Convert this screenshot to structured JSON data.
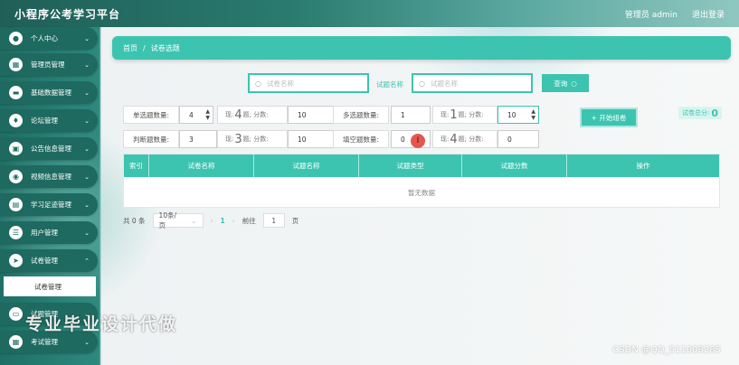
{
  "header": {
    "title": "小程序公考学习平台",
    "admin_label": "管理员 admin",
    "logout_label": "退出登录"
  },
  "sidebar": {
    "items": [
      {
        "label": "个人中心",
        "icon": "user-icon"
      },
      {
        "label": "管理员管理",
        "icon": "grid-icon"
      },
      {
        "label": "基础数据管理",
        "icon": "briefcase-icon"
      },
      {
        "label": "论坛管理",
        "icon": "thumb-icon"
      },
      {
        "label": "公告信息管理",
        "icon": "calendar-icon"
      },
      {
        "label": "视频信息管理",
        "icon": "pin-icon"
      },
      {
        "label": "学习足迹管理",
        "icon": "clipboard-icon"
      },
      {
        "label": "用户管理",
        "icon": "sliders-icon"
      },
      {
        "label": "试卷管理",
        "icon": "send-icon"
      },
      {
        "label": "试题管理",
        "icon": "ticket-icon"
      },
      {
        "label": "考试管理",
        "icon": "grid-icon"
      }
    ],
    "sub_item": "试卷管理"
  },
  "breadcrumb": {
    "home": "首页",
    "sep": "/",
    "current": "试卷选题"
  },
  "search": {
    "paper_placeholder": "试卷名称",
    "question_label": "试题名称",
    "question_placeholder": "试题名称",
    "query_label": "查询"
  },
  "config": {
    "single": {
      "label": "单选题数量:",
      "value": "4",
      "have_prefix": "现:",
      "have_count": "4",
      "have_suffix": "题; 分数:",
      "score": "10"
    },
    "multi": {
      "label": "多选题数量:",
      "value": "1",
      "have_prefix": "现:",
      "have_count": "1",
      "have_suffix": "题; 分数:",
      "score": "10"
    },
    "judge": {
      "label": "判断题数量:",
      "value": "3",
      "have_prefix": "现:",
      "have_count": "3",
      "have_suffix": "题; 分数:",
      "score": "10"
    },
    "fill": {
      "label": "填空题数量:",
      "value": "0",
      "have_prefix": "现:",
      "have_count": "4",
      "have_suffix": "题; 分数:",
      "score": "0"
    },
    "generate_label": "+ 开始组卷",
    "total_label": "试卷总分:",
    "total_value": "0"
  },
  "table": {
    "headers": [
      "索引",
      "试卷名称",
      "试题名称",
      "试题类型",
      "试题分数",
      "操作"
    ],
    "empty_text": "暂无数据"
  },
  "pager": {
    "total": "共 0 条",
    "page_size": "10条/页",
    "prev": "‹",
    "current": "1",
    "next": "›",
    "goto": "前往",
    "goto_value": "1",
    "page_unit": "页"
  },
  "overlay": {
    "watermark": "专业毕业设计代做",
    "csdn": "CSDN @QQ_511008285"
  },
  "colors": {
    "accent": "#3cc4b0",
    "sidebar": "#1e6a60"
  }
}
